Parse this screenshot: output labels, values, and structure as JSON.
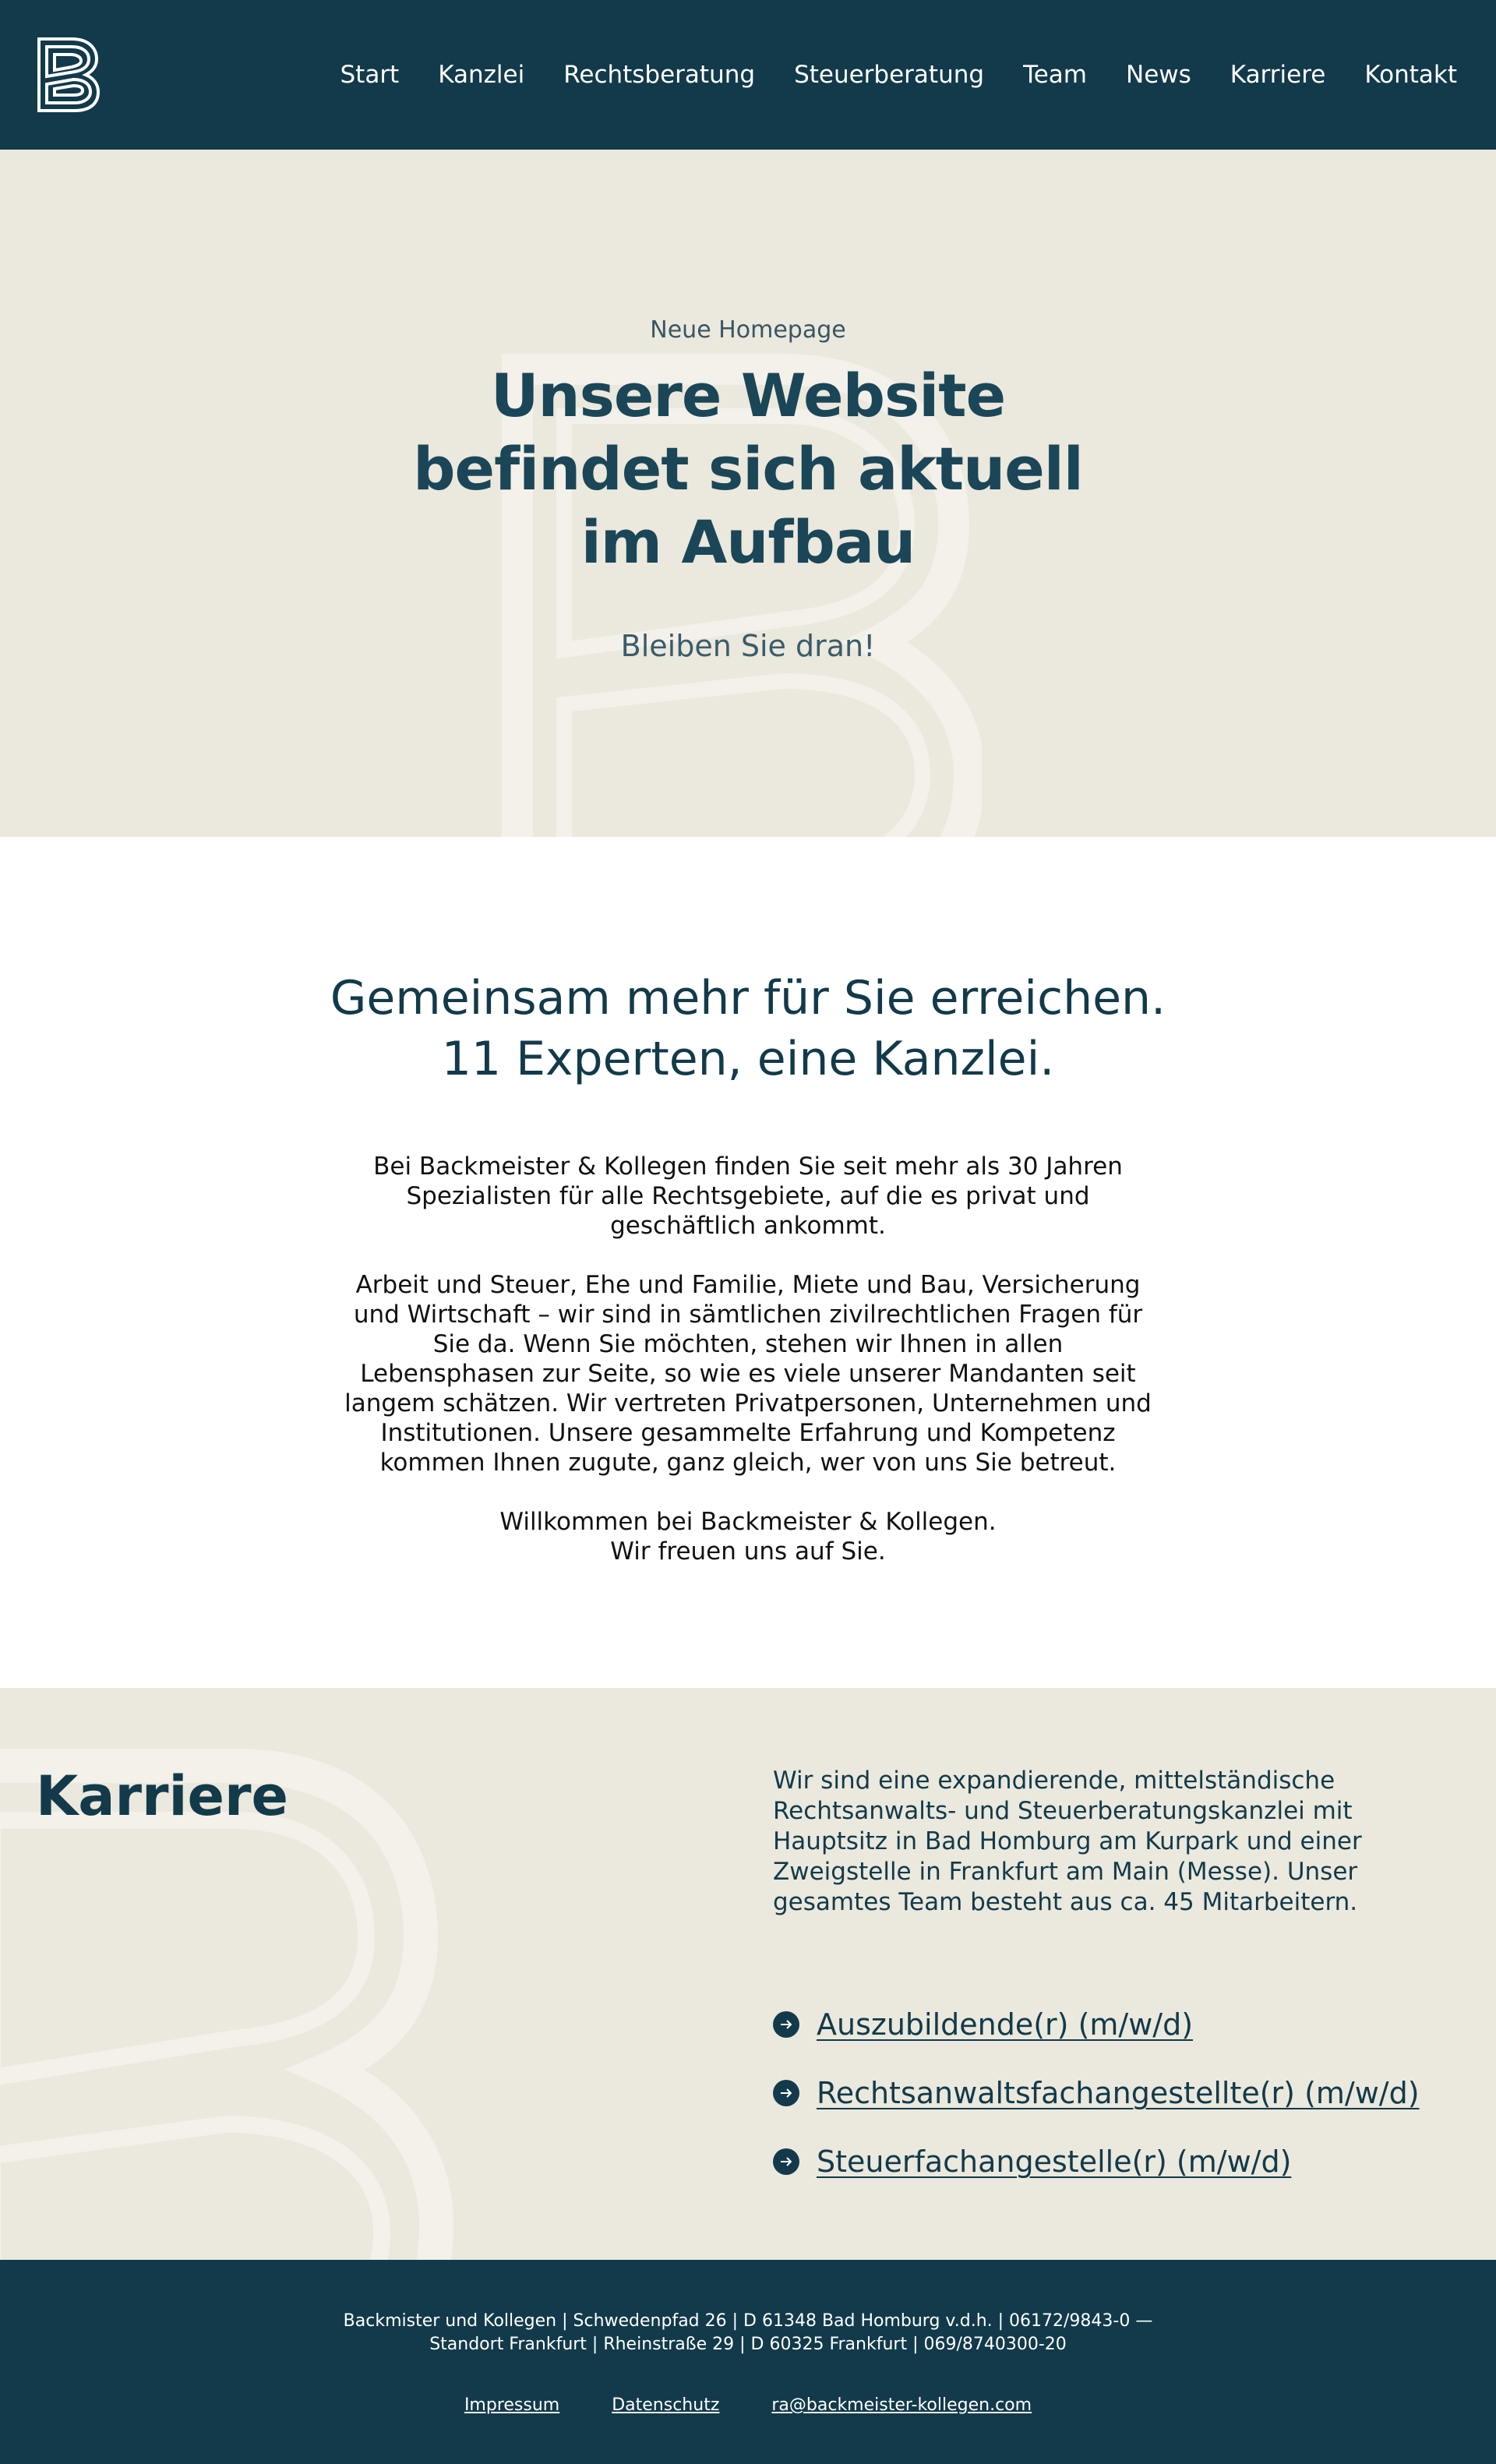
{
  "header": {
    "logo_icon": "b-logo-icon",
    "nav": [
      "Start",
      "Kanzlei",
      "Rechtsberatung",
      "Steuerberatung",
      "Team",
      "News",
      "Karriere",
      "Kontakt"
    ]
  },
  "hero": {
    "kicker": "Neue Homepage",
    "title_lines": [
      "Unsere Website",
      "befindet sich aktuell",
      "im Aufbau"
    ],
    "subtitle": "Bleiben Sie dran!"
  },
  "intro": {
    "heading_lines": [
      "Gemeinsam mehr für Sie erreichen.",
      "11 Experten, eine Kanzlei."
    ],
    "paragraphs": [
      "Bei Backmeister & Kollegen finden Sie seit mehr als 30 Jahren Spezialisten für alle Rechtsgebiete, auf die es privat und geschäftlich ankommt.",
      "Arbeit und Steuer, Ehe und Familie, Miete und Bau, Versicherung und Wirtschaft – wir sind in sämtlichen zivilrechtlichen Fragen für Sie da. Wenn Sie möchten, stehen wir Ihnen in allen Lebensphasen zur Seite, so wie es viele unserer Mandanten seit langem schätzen. Wir vertreten Privatpersonen, Unternehmen und Institutionen. Unsere gesammelte Erfahrung und Kompetenz kommen Ihnen zugute, ganz gleich, wer von uns Sie betreut."
    ],
    "closing_lines": [
      "Willkommen bei Backmeister & Kollegen.",
      "Wir freuen uns auf Sie."
    ]
  },
  "karriere": {
    "title": "Karriere",
    "description": "Wir sind eine expandierende, mittelständische Rechtsanwalts- und Steuerberatungskanzlei mit Hauptsitz in Bad Homburg am Kurpark und einer Zweigstelle in Frankfurt am Main (Messe). Unser gesamtes Team besteht aus ca. 45 Mitarbeitern.",
    "jobs": [
      "Auszubildende(r) (m/w/d)",
      "Rechtsanwaltsfachangestellte(r) (m/w/d)",
      "Steuerfachangestelle(r) (m/w/d)"
    ],
    "job_icon": "arrow-right-icon"
  },
  "footer": {
    "address_line1": "Backmister und Kollegen | Schwedenpfad 26 | D 61348 Bad Homburg v.d.h. | 06172/9843-0 —",
    "address_line2": "Standort Frankfurt | Rheinstraße 29 | D 60325 Frankfurt | 069/8740300-20",
    "links": [
      "Impressum",
      "Datenschutz",
      "ra@backmeister-kollegen.com"
    ]
  },
  "colors": {
    "brand_dark": "#123a4b",
    "beige": "#ebe8dd"
  }
}
